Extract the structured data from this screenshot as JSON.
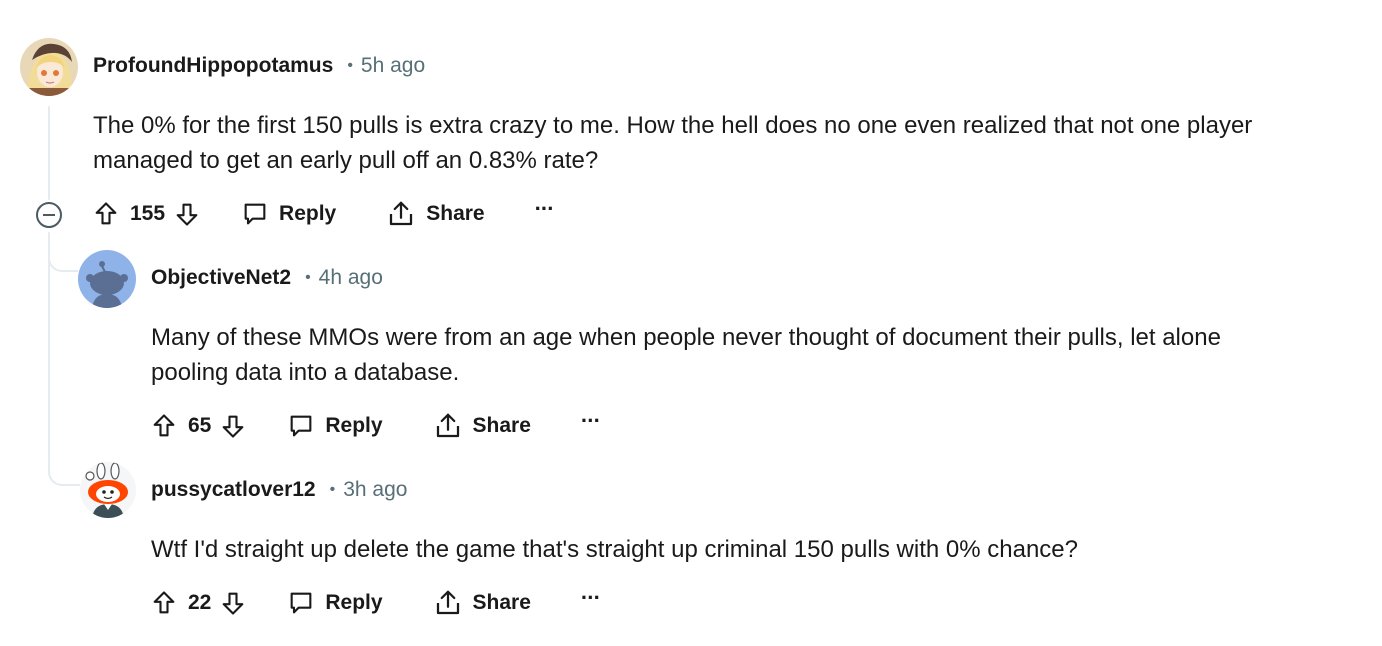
{
  "comments": [
    {
      "username": "ProfoundHippopotamus",
      "separator": "•",
      "time": "5h ago",
      "body": "The 0% for the first 150 pulls is extra crazy to me. How the hell does no one even realized that not one player\nmanaged to get an early pull off an 0.83% rate?",
      "score": "155",
      "reply_label": "Reply",
      "share_label": "Share",
      "more_label": "···",
      "avatar": "anime-character-avatar"
    },
    {
      "username": "ObjectiveNet2",
      "separator": "•",
      "time": "4h ago",
      "body": "Many of these MMOs were from an age when people never thought of document their pulls, let alone\npooling data into a database.",
      "score": "65",
      "reply_label": "Reply",
      "share_label": "Share",
      "more_label": "···",
      "avatar": "default-snoo-avatar"
    },
    {
      "username": "pussycatlover12",
      "separator": "•",
      "time": "3h ago",
      "body": "Wtf I'd straight up delete the game that's straight up criminal 150 pulls with 0% chance?",
      "score": "22",
      "reply_label": "Reply",
      "share_label": "Share",
      "more_label": "···",
      "avatar": "snoo-bunny-ears-avatar"
    }
  ],
  "colors": {
    "text": "#1a1a1b",
    "meta": "#576f76",
    "thread_line": "#e5ebee",
    "snoo_bg": "#8fb2e8",
    "snoo_accent": "#ff4500"
  }
}
